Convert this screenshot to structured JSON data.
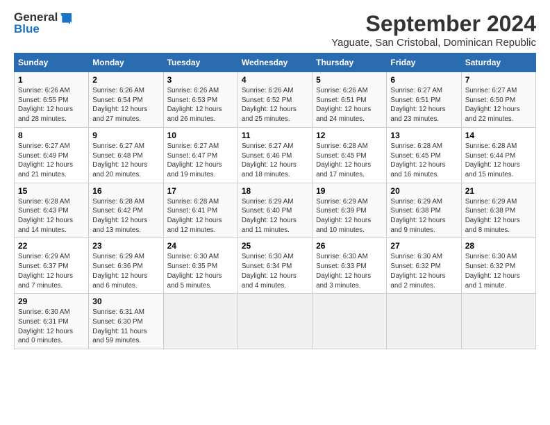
{
  "header": {
    "logo_line1": "General",
    "logo_line2": "Blue",
    "title": "September 2024",
    "subtitle": "Yaguate, San Cristobal, Dominican Republic"
  },
  "days_of_week": [
    "Sunday",
    "Monday",
    "Tuesday",
    "Wednesday",
    "Thursday",
    "Friday",
    "Saturday"
  ],
  "weeks": [
    [
      {
        "day": "1",
        "info": "Sunrise: 6:26 AM\nSunset: 6:55 PM\nDaylight: 12 hours\nand 28 minutes."
      },
      {
        "day": "2",
        "info": "Sunrise: 6:26 AM\nSunset: 6:54 PM\nDaylight: 12 hours\nand 27 minutes."
      },
      {
        "day": "3",
        "info": "Sunrise: 6:26 AM\nSunset: 6:53 PM\nDaylight: 12 hours\nand 26 minutes."
      },
      {
        "day": "4",
        "info": "Sunrise: 6:26 AM\nSunset: 6:52 PM\nDaylight: 12 hours\nand 25 minutes."
      },
      {
        "day": "5",
        "info": "Sunrise: 6:26 AM\nSunset: 6:51 PM\nDaylight: 12 hours\nand 24 minutes."
      },
      {
        "day": "6",
        "info": "Sunrise: 6:27 AM\nSunset: 6:51 PM\nDaylight: 12 hours\nand 23 minutes."
      },
      {
        "day": "7",
        "info": "Sunrise: 6:27 AM\nSunset: 6:50 PM\nDaylight: 12 hours\nand 22 minutes."
      }
    ],
    [
      {
        "day": "8",
        "info": "Sunrise: 6:27 AM\nSunset: 6:49 PM\nDaylight: 12 hours\nand 21 minutes."
      },
      {
        "day": "9",
        "info": "Sunrise: 6:27 AM\nSunset: 6:48 PM\nDaylight: 12 hours\nand 20 minutes."
      },
      {
        "day": "10",
        "info": "Sunrise: 6:27 AM\nSunset: 6:47 PM\nDaylight: 12 hours\nand 19 minutes."
      },
      {
        "day": "11",
        "info": "Sunrise: 6:27 AM\nSunset: 6:46 PM\nDaylight: 12 hours\nand 18 minutes."
      },
      {
        "day": "12",
        "info": "Sunrise: 6:28 AM\nSunset: 6:45 PM\nDaylight: 12 hours\nand 17 minutes."
      },
      {
        "day": "13",
        "info": "Sunrise: 6:28 AM\nSunset: 6:45 PM\nDaylight: 12 hours\nand 16 minutes."
      },
      {
        "day": "14",
        "info": "Sunrise: 6:28 AM\nSunset: 6:44 PM\nDaylight: 12 hours\nand 15 minutes."
      }
    ],
    [
      {
        "day": "15",
        "info": "Sunrise: 6:28 AM\nSunset: 6:43 PM\nDaylight: 12 hours\nand 14 minutes."
      },
      {
        "day": "16",
        "info": "Sunrise: 6:28 AM\nSunset: 6:42 PM\nDaylight: 12 hours\nand 13 minutes."
      },
      {
        "day": "17",
        "info": "Sunrise: 6:28 AM\nSunset: 6:41 PM\nDaylight: 12 hours\nand 12 minutes."
      },
      {
        "day": "18",
        "info": "Sunrise: 6:29 AM\nSunset: 6:40 PM\nDaylight: 12 hours\nand 11 minutes."
      },
      {
        "day": "19",
        "info": "Sunrise: 6:29 AM\nSunset: 6:39 PM\nDaylight: 12 hours\nand 10 minutes."
      },
      {
        "day": "20",
        "info": "Sunrise: 6:29 AM\nSunset: 6:38 PM\nDaylight: 12 hours\nand 9 minutes."
      },
      {
        "day": "21",
        "info": "Sunrise: 6:29 AM\nSunset: 6:38 PM\nDaylight: 12 hours\nand 8 minutes."
      }
    ],
    [
      {
        "day": "22",
        "info": "Sunrise: 6:29 AM\nSunset: 6:37 PM\nDaylight: 12 hours\nand 7 minutes."
      },
      {
        "day": "23",
        "info": "Sunrise: 6:29 AM\nSunset: 6:36 PM\nDaylight: 12 hours\nand 6 minutes."
      },
      {
        "day": "24",
        "info": "Sunrise: 6:30 AM\nSunset: 6:35 PM\nDaylight: 12 hours\nand 5 minutes."
      },
      {
        "day": "25",
        "info": "Sunrise: 6:30 AM\nSunset: 6:34 PM\nDaylight: 12 hours\nand 4 minutes."
      },
      {
        "day": "26",
        "info": "Sunrise: 6:30 AM\nSunset: 6:33 PM\nDaylight: 12 hours\nand 3 minutes."
      },
      {
        "day": "27",
        "info": "Sunrise: 6:30 AM\nSunset: 6:32 PM\nDaylight: 12 hours\nand 2 minutes."
      },
      {
        "day": "28",
        "info": "Sunrise: 6:30 AM\nSunset: 6:32 PM\nDaylight: 12 hours\nand 1 minute."
      }
    ],
    [
      {
        "day": "29",
        "info": "Sunrise: 6:30 AM\nSunset: 6:31 PM\nDaylight: 12 hours\nand 0 minutes."
      },
      {
        "day": "30",
        "info": "Sunrise: 6:31 AM\nSunset: 6:30 PM\nDaylight: 11 hours\nand 59 minutes."
      },
      {
        "day": "",
        "info": ""
      },
      {
        "day": "",
        "info": ""
      },
      {
        "day": "",
        "info": ""
      },
      {
        "day": "",
        "info": ""
      },
      {
        "day": "",
        "info": ""
      }
    ]
  ]
}
